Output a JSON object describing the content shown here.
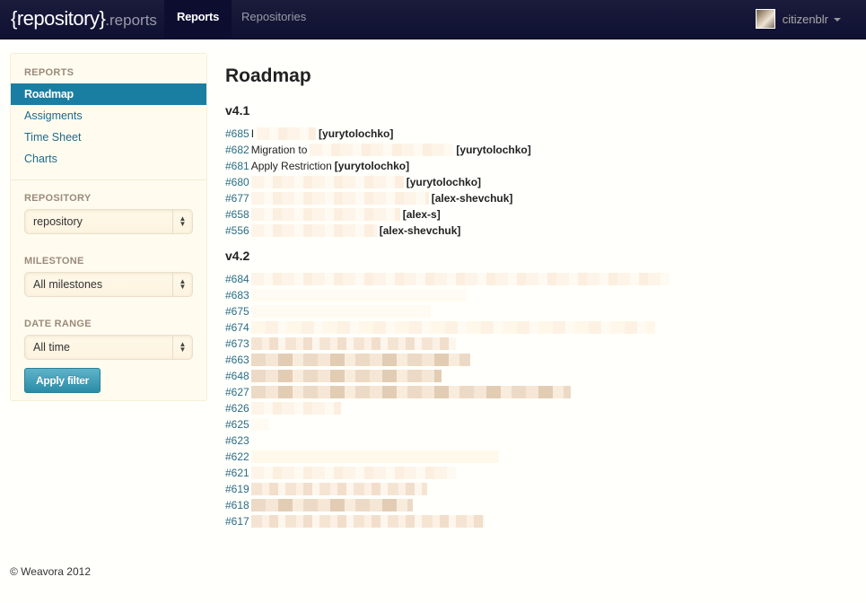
{
  "navbar": {
    "brand": "{repository}",
    "brand_suffix": ".reports",
    "items": [
      {
        "label": "Reports",
        "active": true
      },
      {
        "label": "Repositories",
        "active": false
      }
    ],
    "user": {
      "name": "citizenblr"
    }
  },
  "sidebar": {
    "reports_header": "REPORTS",
    "links": [
      {
        "label": "Roadmap",
        "active": true
      },
      {
        "label": "Assigments",
        "active": false
      },
      {
        "label": "Time Sheet",
        "active": false
      },
      {
        "label": "Charts",
        "active": false
      }
    ],
    "filters": [
      {
        "label": "REPOSITORY",
        "value": "repository"
      },
      {
        "label": "MILESTONE",
        "value": "All milestones"
      },
      {
        "label": "DATE RANGE",
        "value": "All time"
      }
    ],
    "apply_label": "Apply filter",
    "arrows_glyph": "▲▼"
  },
  "main": {
    "title": "Roadmap",
    "milestones": [
      {
        "version": "v4.1",
        "issues": [
          {
            "number": "#685",
            "text": "I",
            "assignee": "[yurytolochko]"
          },
          {
            "number": "#682",
            "text": "Migration to",
            "assignee": "[yurytolochko]"
          },
          {
            "number": "#681",
            "text": "Apply Restriction",
            "assignee": "[yurytolochko]"
          },
          {
            "number": "#680",
            "text": "",
            "assignee": "[yurytolochko]"
          },
          {
            "number": "#677",
            "text": "",
            "assignee": "[alex-shevchuk]"
          },
          {
            "number": "#658",
            "text": "",
            "assignee": "[alex-s]"
          },
          {
            "number": "#556",
            "text": "",
            "assignee": "[alex-shevchuk]"
          }
        ]
      },
      {
        "version": "v4.2",
        "issues": [
          {
            "number": "#684"
          },
          {
            "number": "#683"
          },
          {
            "number": "#675"
          },
          {
            "number": "#674"
          },
          {
            "number": "#673"
          },
          {
            "number": "#663"
          },
          {
            "number": "#648"
          },
          {
            "number": "#627"
          },
          {
            "number": "#626"
          },
          {
            "number": "#625"
          },
          {
            "number": "#623"
          },
          {
            "number": "#622"
          },
          {
            "number": "#621"
          },
          {
            "number": "#619"
          },
          {
            "number": "#618"
          },
          {
            "number": "#617"
          }
        ]
      }
    ]
  },
  "footer": {
    "copyright": "© Weavora 2012"
  },
  "colors": {
    "navbar": "#0f1133",
    "accent": "#1a7ea3",
    "link": "#2a6d86",
    "sidebar_bg": "#fffcef"
  }
}
